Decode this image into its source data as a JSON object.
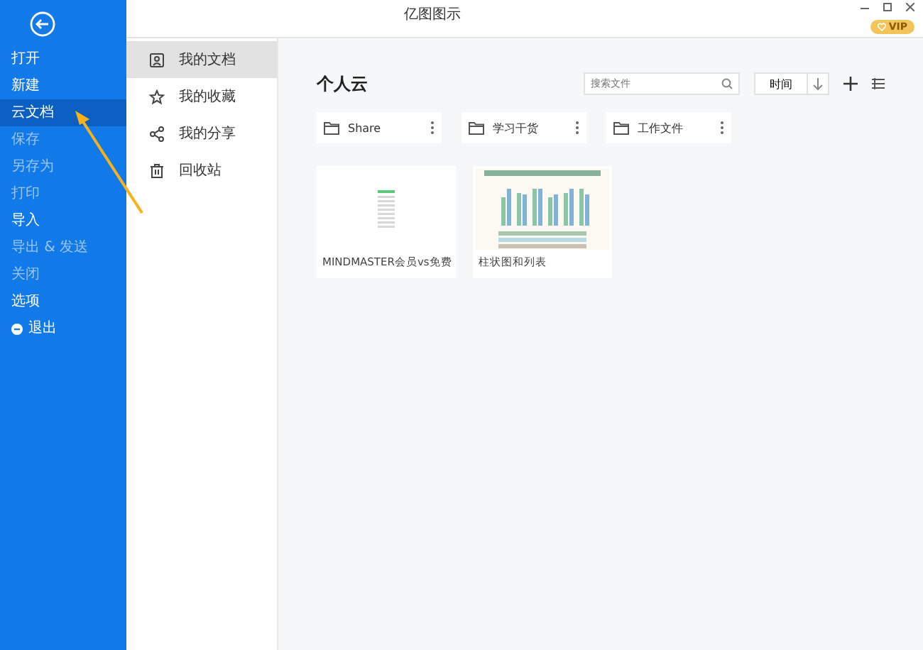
{
  "window": {
    "title": "亿图图示",
    "vip": "VIP"
  },
  "menu": [
    {
      "label": "打开",
      "selected": false,
      "disabled": false
    },
    {
      "label": "新建",
      "selected": false,
      "disabled": false
    },
    {
      "label": "云文档",
      "selected": true,
      "disabled": false
    },
    {
      "label": "保存",
      "selected": false,
      "disabled": true
    },
    {
      "label": "另存为",
      "selected": false,
      "disabled": true
    },
    {
      "label": "打印",
      "selected": false,
      "disabled": true
    },
    {
      "label": "导入",
      "selected": false,
      "disabled": false
    },
    {
      "label": "导出 & 发送",
      "selected": false,
      "disabled": true
    },
    {
      "label": "关闭",
      "selected": false,
      "disabled": true
    },
    {
      "label": "选项",
      "selected": false,
      "disabled": false
    },
    {
      "label": "退出",
      "selected": false,
      "disabled": false,
      "kind": "exit"
    }
  ],
  "nav": [
    {
      "label": "我的文档",
      "selected": true,
      "kind": "docs"
    },
    {
      "label": "我的收藏",
      "selected": false,
      "kind": "star"
    },
    {
      "label": "我的分享",
      "selected": false,
      "kind": "share"
    },
    {
      "label": "回收站",
      "selected": false,
      "kind": "trash"
    }
  ],
  "heading": "个人云",
  "search": {
    "placeholder": "搜索文件"
  },
  "sort": {
    "label": "时间"
  },
  "folders": [
    "Share",
    "学习干货",
    "工作文件"
  ],
  "files": [
    {
      "name": "MINDMASTER会员vs免费",
      "kind": "list"
    },
    {
      "name": "柱状图和列表",
      "kind": "chart"
    }
  ]
}
